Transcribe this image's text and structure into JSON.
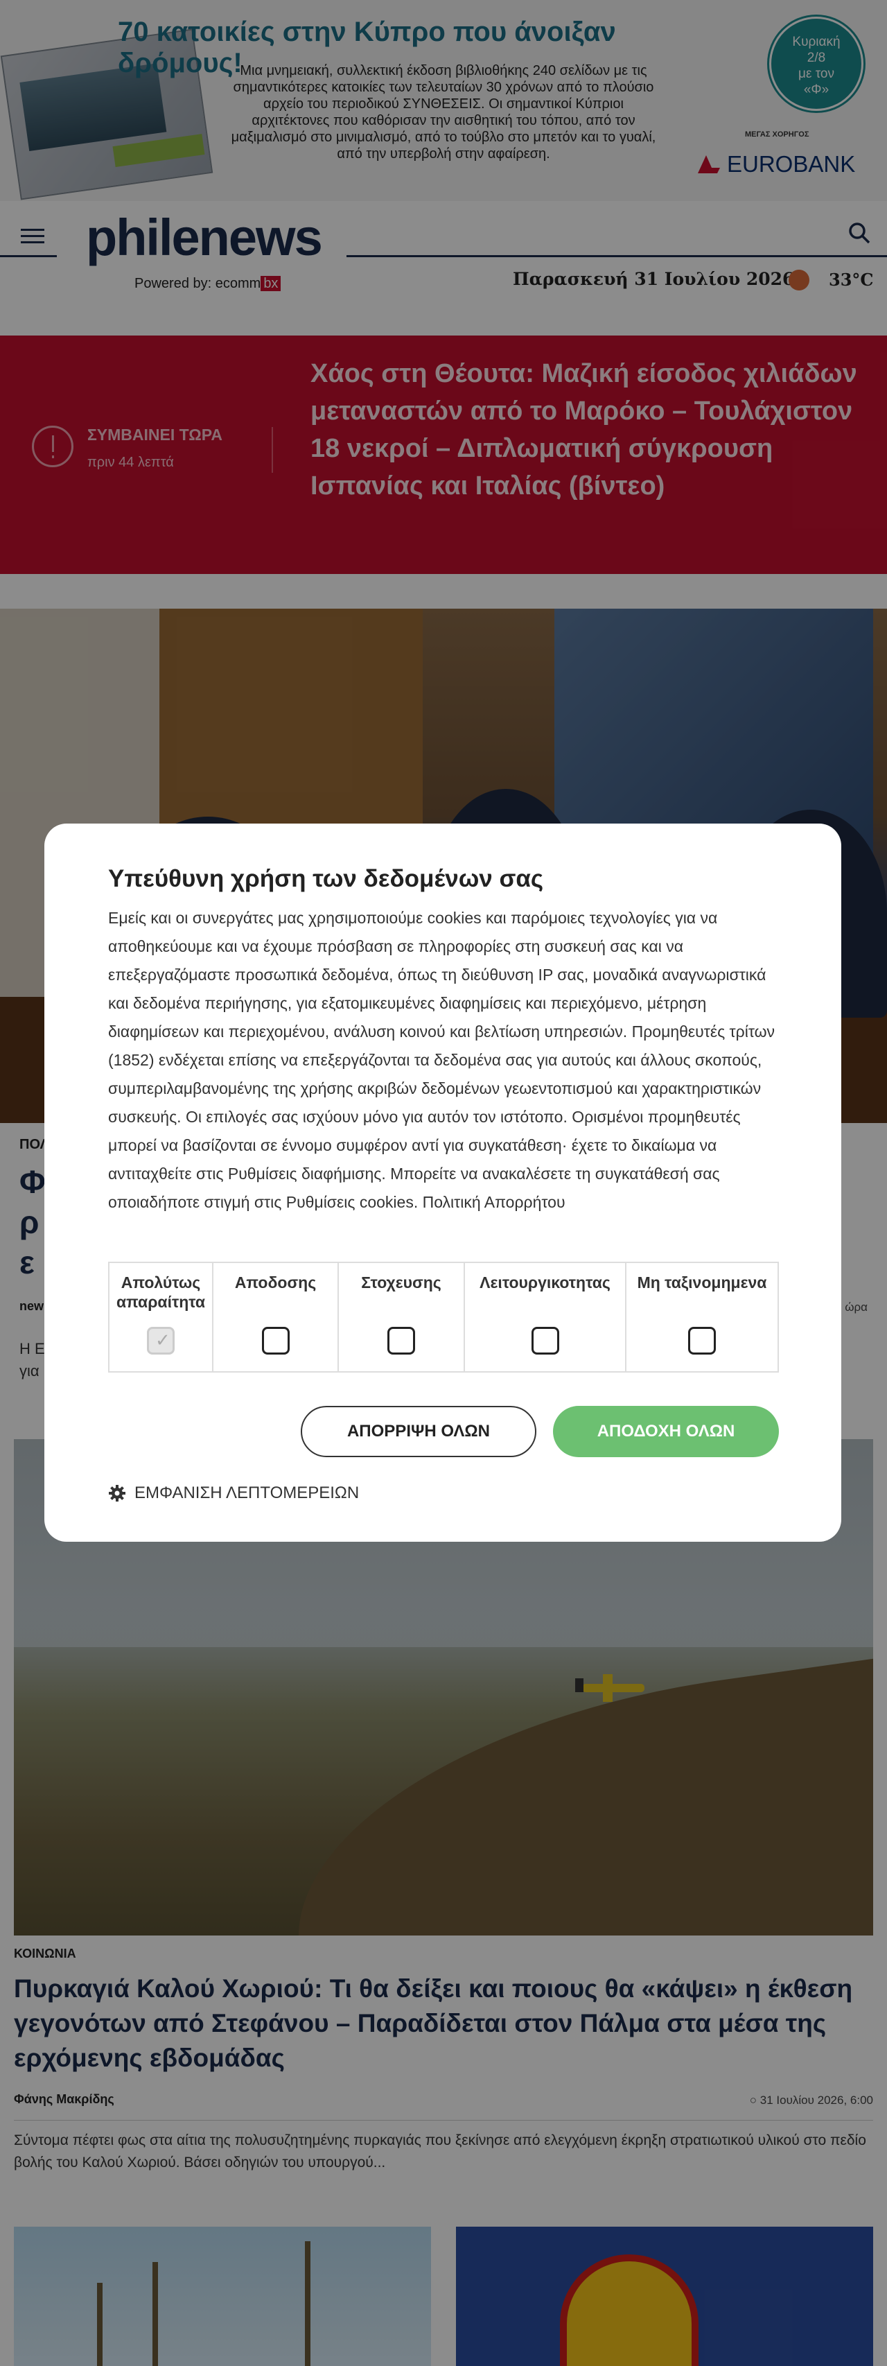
{
  "ad": {
    "headline": "70 κατοικίες στην Κύπρο που άνοιξαν δρόμους!",
    "body": "Μια μνημειακή, συλλεκτική έκδοση βιβλιοθήκης 240 σελίδων με τις σημαντικότερες κατοικίες των τελευταίων 30 χρόνων από το πλούσιο αρχείο του περιοδικού ΣΥΝΘΕΣΕΙΣ. Οι σημαντικοί Κύπριοι αρχιτέκτονες που καθόρισαν την αισθητική του τόπου, από τον μαξιμαλισμό στο μινιμαλισμό, από το τούβλο στο μπετόν και το γυαλί, από την υπερβολή στην αφαίρεση.",
    "circle_line1": "Κυριακή",
    "circle_line2": "2/8",
    "circle_line3": "με τον",
    "circle_line4": "«Φ»",
    "sponsor_label": "ΜΕΓΑΣ ΧΟΡΗΓΟΣ",
    "sponsor_name": "EUROBANK"
  },
  "header": {
    "logo": "philenews",
    "powered_prefix": "Powered by:",
    "powered_brand": "ecomm",
    "powered_bx": "bx",
    "date": "Παρασκευή 31 Ιουλίου 2026",
    "temperature": "33°C",
    "menu_icon": "hamburger-icon",
    "search_icon": "search-icon"
  },
  "breaking": {
    "label": "ΣΥΜΒΑΙΝΕΙ ΤΩΡΑ",
    "time": "πριν 44 λεπτά",
    "title": "Χάος στη Θέουτα: Μαζική είσοδος χιλιάδων μεταναστών από το Μαρόκο – Τουλάχιστον 18 νεκροί – Διπλωματική σύγκρουση Ισπανίας και Ιταλίας (βίντεο)"
  },
  "main_article": {
    "category": "ΠΟΛ",
    "title_partial": "Φ\nρ\nε",
    "author": "new",
    "date": "ώρα",
    "excerpt": "Η Ε                                                                                                                                              Ε\nγια"
  },
  "article2": {
    "category": "ΚΟΙΝΩΝΙΑ",
    "title": "Πυρκαγιά Καλού Χωριού: Τι θα δείξει και ποιους θα «κάψει» η έκθεση γεγονότων από Στεφάνου – Παραδίδεται στον Πάλμα στα μέσα της ερχόμενης εβδομάδας",
    "author": "Φάνης Μακρίδης",
    "date": "31 Ιουλίου 2026, 6:00",
    "excerpt": "Σύντομα πέφτει φως στα αίτια της πολυσυζητημένης πυρκαγιάς που ξεκίνησε από ελεγχόμενη έκρηξη στρατιωτικού υλικού στο πεδίο βολής του Καλού Χωριού. Βάσει οδηγιών του υπουργού..."
  },
  "consent": {
    "title": "Υπεύθυνη χρήση των δεδομένων σας",
    "text": "Εμείς και οι συνεργάτες μας χρησιμοποιούμε cookies και παρόμοιες τεχνολογίες για να αποθηκεύουμε και να έχουμε πρόσβαση σε πληροφορίες στη συσκευή σας και να επεξεργαζόμαστε προσωπικά δεδομένα, όπως τη διεύθυνση IP σας, μοναδικά αναγνωριστικά και δεδομένα περιήγησης, για εξατομικευμένες διαφημίσεις και περιεχόμενο, μέτρηση διαφημίσεων και περιεχομένου, ανάλυση κοινού και βελτίωση υπηρεσιών. Προμηθευτές τρίτων (1852) ενδέχεται επίσης να επεξεργάζονται τα δεδομένα σας για αυτούς και άλλους σκοπούς, συμπεριλαμβανομένης της χρήσης ακριβών δεδομένων γεωεντοπισμού και χαρακτηριστικών συσκευής. Οι επιλογές σας ισχύουν μόνο για αυτόν τον ιστότοπο. Ορισμένοι προμηθευτές μπορεί να βασίζονται σε έννομο συμφέρον αντί για συγκατάθεση· έχετε το δικαίωμα να αντιταχθείτε στις Ρυθμίσεις διαφήμισης. Μπορείτε να ανακαλέσετε τη συγκατάθεσή σας οποιαδήποτε στιγμή στις Ρυθμίσεις cookies. Πολιτική Απορρήτου",
    "categories": [
      {
        "label": "Απολύτως απαραίτητα",
        "checked": true,
        "disabled": true
      },
      {
        "label": "Αποδοσης",
        "checked": false,
        "disabled": false
      },
      {
        "label": "Στοχευσης",
        "checked": false,
        "disabled": false
      },
      {
        "label": "Λειτουργικοτητας",
        "checked": false,
        "disabled": false
      },
      {
        "label": "Μη ταξινομημενα",
        "checked": false,
        "disabled": false
      }
    ],
    "reject_label": "ΑΠΟΡΡΙΨΗ ΟΛΩΝ",
    "accept_label": "ΑΠΟΔΟΧΗ ΟΛΩΝ",
    "details_label": "ΕΜΦΑΝΙΣΗ ΛΕΠΤΟΜΕΡΕΙΩΝ",
    "accept_color": "#6cc071"
  },
  "colors": {
    "brand_navy": "#1a2b4c",
    "breaking_red": "#c4102f",
    "ad_teal": "#1d6d86"
  }
}
